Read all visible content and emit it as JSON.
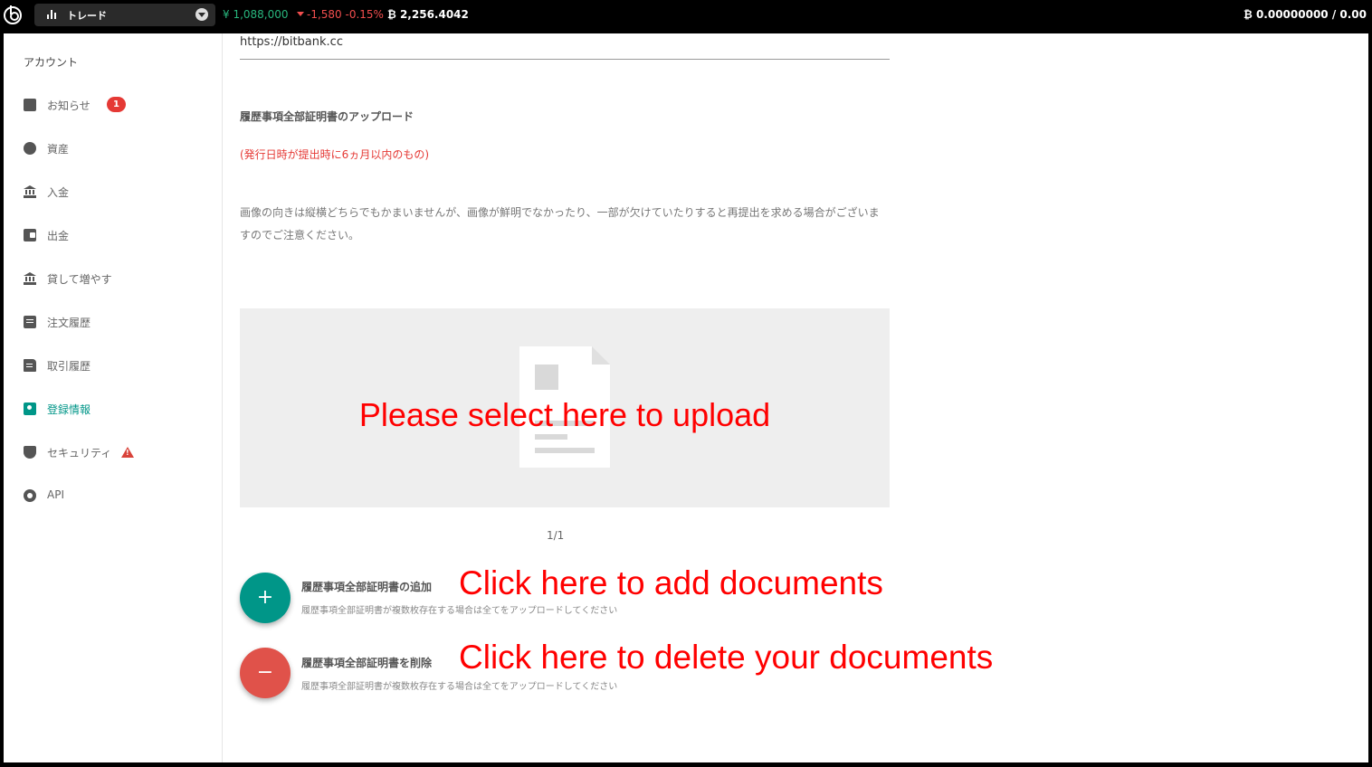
{
  "topbar": {
    "trade_label": "トレード",
    "price_jpy": "¥ 1,088,000",
    "price_change": "-1,580 -0.15%",
    "price_btc": "₿ 2,256.4042",
    "balance": "₿ 0.00000000 / 0.00",
    "colors": {
      "up": "#28b67d",
      "down": "#f24e4e"
    }
  },
  "sidebar": {
    "title": "アカウント",
    "items": [
      {
        "label": "お知らせ",
        "icon": "message-icon",
        "badge": "1"
      },
      {
        "label": "資産",
        "icon": "pie-chart-icon"
      },
      {
        "label": "入金",
        "icon": "bank-icon"
      },
      {
        "label": "出金",
        "icon": "wallet-icon"
      },
      {
        "label": "貸して増やす",
        "icon": "bank-icon"
      },
      {
        "label": "注文履歴",
        "icon": "clipboard-icon"
      },
      {
        "label": "取引履歴",
        "icon": "document-icon"
      },
      {
        "label": "登録情報",
        "icon": "id-badge-icon",
        "active": true
      },
      {
        "label": "セキュリティ",
        "icon": "shield-icon",
        "warning": true
      },
      {
        "label": "API",
        "icon": "gear-icon"
      }
    ]
  },
  "content": {
    "url": "https://bitbank.cc",
    "section_title": "履歴事項全部証明書のアップロード",
    "notice": "(発行日時が提出時に6ヵ月以内のもの)",
    "description": "画像の向きは縦横どちらでもかまいませんが、画像が鮮明でなかったり、一部が欠けていたりすると再提出を求める場合がございますのでご注意ください。",
    "upload_overlay": "Please select here to upload",
    "pager": "1/1",
    "add": {
      "title": "履歴事項全部証明書の追加",
      "subtitle": "履歴事項全部証明書が複数枚存在する場合は全てをアップロードしてください",
      "overlay": "Click here to add documents",
      "icon": "+"
    },
    "delete": {
      "title": "履歴事項全部証明書を削除",
      "subtitle": "履歴事項全部証明書が複数枚存在する場合は全てをアップロードしてください",
      "overlay": "Click here to delete your documents",
      "icon": "−"
    },
    "colors": {
      "accent": "#009688",
      "danger": "#e0524a",
      "annotation": "#ff0000"
    }
  }
}
